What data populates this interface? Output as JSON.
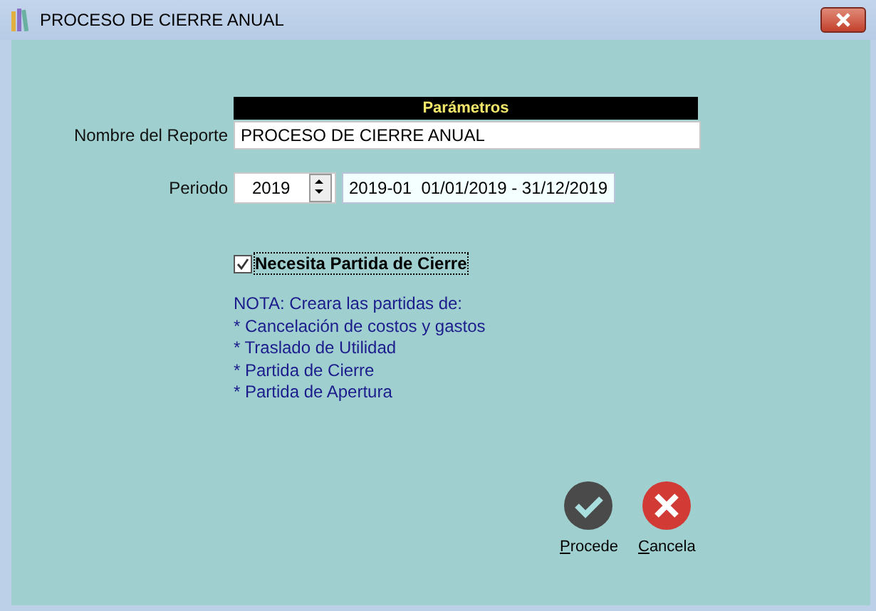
{
  "window": {
    "title": "PROCESO DE CIERRE ANUAL"
  },
  "header": "Parámetros",
  "report_name": {
    "label": "Nombre del Reporte",
    "value": "PROCESO DE CIERRE ANUAL"
  },
  "period": {
    "label": "Periodo",
    "year": "2019",
    "range": "2019-01  01/01/2019 - 31/12/2019"
  },
  "closing_entry": {
    "label": "Necesita Partida de Cierre",
    "checked": true
  },
  "note": [
    "NOTA: Creara las partidas de:",
    "* Cancelación de costos y gastos",
    "* Traslado de Utilidad",
    "* Partida de Cierre",
    "* Partida de Apertura"
  ],
  "buttons": [
    {
      "kind": "ok",
      "label": "Procede"
    },
    {
      "kind": "cancel",
      "label": "Cancela"
    }
  ]
}
